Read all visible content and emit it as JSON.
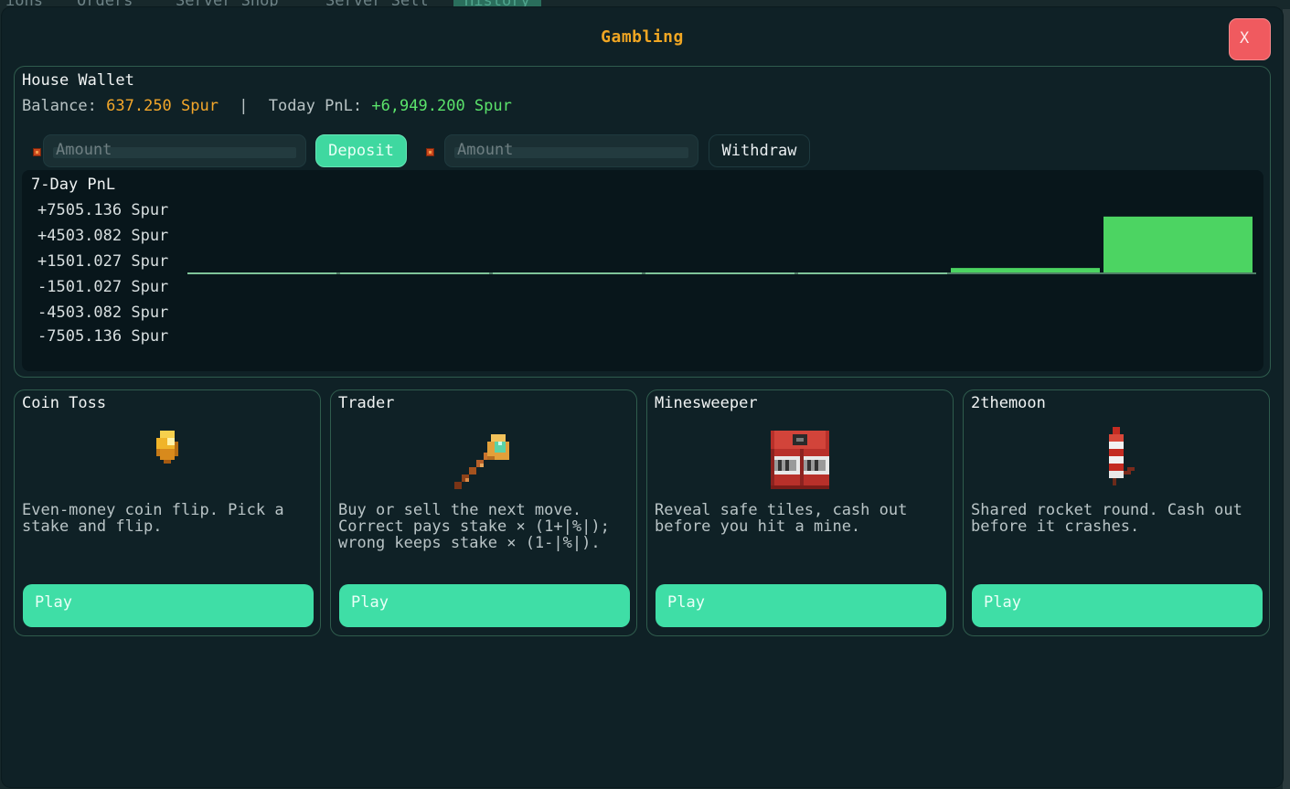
{
  "background_tabs": [
    "ions",
    "Orders",
    "Server Shop",
    "Server Sell",
    "History"
  ],
  "window": {
    "title": "Gambling",
    "close_label": "X"
  },
  "wallet": {
    "title": "House Wallet",
    "balance_label": "Balance:",
    "balance_value": "637.250 Spur",
    "separator": "|",
    "pnl_label": "Today PnL:",
    "pnl_value": "+6,949.200 Spur",
    "deposit_placeholder": "Amount",
    "deposit_label": "Deposit",
    "withdraw_placeholder": "Amount",
    "withdraw_label": "Withdraw"
  },
  "chart_data": {
    "type": "bar",
    "title": "7-Day PnL",
    "unit": "Spur",
    "y_tick_labels": [
      "+7505.136 Spur",
      "+4503.082 Spur",
      "+1501.027 Spur",
      "-1501.027 Spur",
      "-4503.082 Spur",
      "-7505.136 Spur"
    ],
    "ylim": [
      -7505.136,
      7505.136
    ],
    "values": [
      0,
      0,
      0,
      0,
      0,
      556.0,
      6949.2
    ],
    "grid": false,
    "legend": "none",
    "colors": {
      "positive": "#4cd462",
      "zero": "#7fc49a",
      "panel": "#08161b"
    }
  },
  "games": [
    {
      "title": "Coin Toss",
      "icon": "gold-nugget-icon",
      "description": "Even-money coin flip. Pick a\nstake and flip.",
      "play_label": "Play"
    },
    {
      "title": "Trader",
      "icon": "magic-staff-icon",
      "description": "Buy or sell the next move.\nCorrect pays stake × (1+|%|);\nwrong keeps stake × (1-|%|).",
      "play_label": "Play"
    },
    {
      "title": "Minesweeper",
      "icon": "tnt-icon",
      "description": "Reveal safe tiles, cash out\nbefore you hit a mine.",
      "play_label": "Play"
    },
    {
      "title": "2themoon",
      "icon": "firework-rocket-icon",
      "description": "Shared rocket round. Cash out\nbefore it crashes.",
      "play_label": "Play"
    }
  ]
}
